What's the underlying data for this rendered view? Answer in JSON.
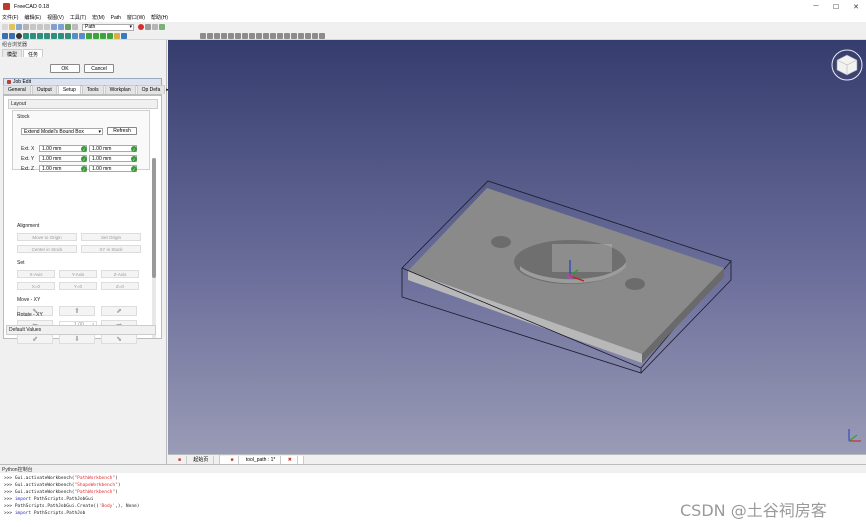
{
  "window": {
    "title": "FreeCAD 0.18"
  },
  "menu": [
    "文件(F)",
    "编辑(E)",
    "视图(V)",
    "工具(T)",
    "宏(M)",
    "Path",
    "窗口(W)",
    "帮助(H)"
  ],
  "toolbar": {
    "workbench": "Path"
  },
  "left_panel": {
    "header": "组合浏览器",
    "tabs": [
      "模型",
      "任务"
    ],
    "ok_label": "OK",
    "cancel_label": "Cancel",
    "job_title": "Job Edit",
    "job_tabs": [
      "General",
      "Output",
      "Setup",
      "Tools",
      "Workplan",
      "Op Defa"
    ],
    "layout_label": "Layout",
    "stock": {
      "title": "Stock",
      "mode": "Extend Model's Bound Box",
      "refresh_label": "Refresh",
      "ext_x_label": "Ext. X",
      "ext_x_neg": "1.00 mm",
      "ext_x_pos": "1.00 mm",
      "ext_y_label": "Ext. Y",
      "ext_y_neg": "1.00 mm",
      "ext_y_pos": "1.00 mm",
      "ext_z_label": "Ext. Z",
      "ext_z_neg": "1.00 mm",
      "ext_z_pos": "1.00 mm"
    },
    "alignment": {
      "title": "Alignment",
      "move_to_origin": "Move to Origin",
      "set_origin": "Set Origin",
      "center_in_stock": "Center in Stock",
      "xy_in_stock": "XY in Stock"
    },
    "set": {
      "title": "Set",
      "x_axis": "X-Axis",
      "y_axis": "Y-Axis",
      "z_axis": "Z-Axis",
      "x0": "X=0",
      "y0": "Y=0",
      "z0": "Z=0"
    },
    "move_xy": {
      "title": "Move - XY",
      "step": "1.00"
    },
    "rotate_xy": {
      "title": "Rotate - XY"
    },
    "default_values": "Default Values"
  },
  "view_tabs": [
    "起始页",
    "tool_path : 1*"
  ],
  "console": {
    "title": "Python控制台",
    "lines": [
      {
        "pre": ">>> Gui.activateWorkbench(",
        "str": "\"PathWorkbench\"",
        "post": ")"
      },
      {
        "pre": ">>> Gui.activateWorkbench(",
        "str": "\"ShapeWorkbench\"",
        "post": ")"
      },
      {
        "pre": ">>> Gui.activateWorkbench(",
        "str": "\"PathWorkbench\"",
        "post": ")"
      },
      {
        "kw": "import",
        "post": " PathScripts.PathJobGui"
      },
      {
        "pre": ">>> PathScripts.PathJobGui.Create((",
        "str": "'Body'",
        "post": ",), None)"
      },
      {
        "kw": "import",
        "post": " PathScripts.PathJob"
      }
    ]
  },
  "watermark": "CSDN @土谷祠房客"
}
